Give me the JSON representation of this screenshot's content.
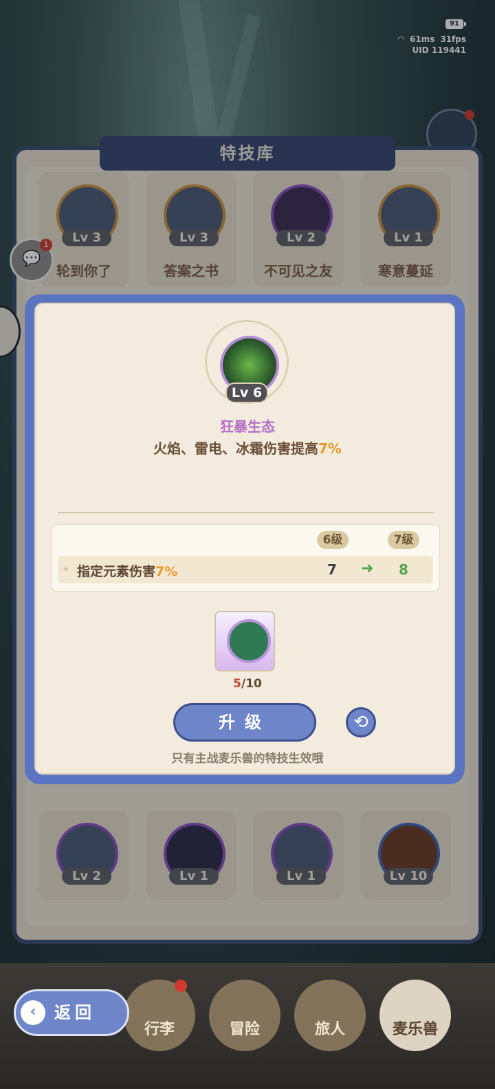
{
  "status": {
    "battery": "91",
    "ping": "61ms",
    "fps": "31fps",
    "uid": "UID 119441"
  },
  "chat": {
    "badge": "1"
  },
  "library": {
    "title": "特技库",
    "top_skills": [
      {
        "level": "Lv 3",
        "name": "轮到你了"
      },
      {
        "level": "Lv 3",
        "name": "答案之书"
      },
      {
        "level": "Lv 2",
        "name": "不可见之友"
      },
      {
        "level": "Lv 1",
        "name": "寒意蔓延"
      }
    ],
    "bottom_skills": [
      {
        "level": "Lv 2"
      },
      {
        "level": "Lv 1"
      },
      {
        "level": "Lv 1"
      },
      {
        "level": "Lv 10"
      }
    ]
  },
  "detail": {
    "level": "Lv 6",
    "name": "狂暴生态",
    "desc_prefix": "火焰、雷电、冰霜伤害提高",
    "desc_value": "7%",
    "current_level_tag": "6级",
    "next_level_tag": "7级",
    "stat_label_prefix": "指定元素伤害",
    "stat_label_value": "7%",
    "stat_current": "7",
    "stat_next": "8",
    "material_have": "5",
    "material_need": "/10",
    "upgrade_label": "升级",
    "hint": "只有主战麦乐兽的特技生效哦"
  },
  "nav": {
    "back_label": "返回",
    "tabs": [
      "行李",
      "冒险",
      "旅人",
      "麦乐兽"
    ],
    "active_tab": "麦乐兽"
  },
  "colors": {
    "accent": "#6e86c9",
    "highlight": "#e69a2a",
    "skill_title": "#b66ec8",
    "positive": "#4ea448"
  }
}
